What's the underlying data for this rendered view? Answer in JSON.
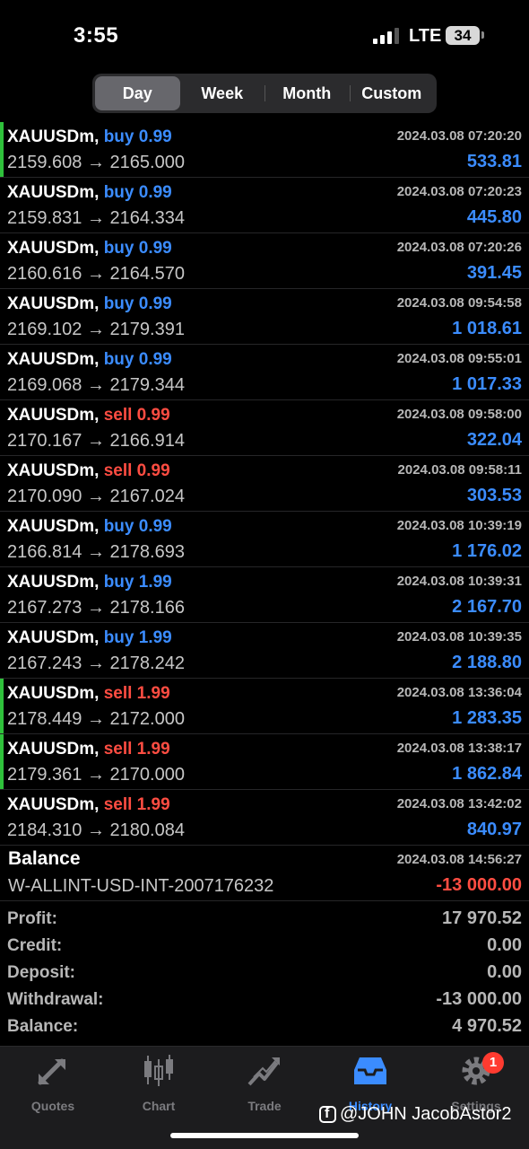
{
  "status_bar": {
    "time": "3:55",
    "network": "LTE",
    "battery": "34"
  },
  "period_tabs": [
    {
      "label": "Day",
      "active": true
    },
    {
      "label": "Week",
      "active": false
    },
    {
      "label": "Month",
      "active": false
    },
    {
      "label": "Custom",
      "active": false
    }
  ],
  "deals": [
    {
      "symbol": "XAUUSDm,",
      "side": "buy",
      "volume": "0.99",
      "datetime": "2024.03.08 07:20:20",
      "prices": "2159.608 → 2165.000",
      "profit": "533.81",
      "marked": true
    },
    {
      "symbol": "XAUUSDm,",
      "side": "buy",
      "volume": "0.99",
      "datetime": "2024.03.08 07:20:23",
      "prices": "2159.831 → 2164.334",
      "profit": "445.80",
      "marked": false
    },
    {
      "symbol": "XAUUSDm,",
      "side": "buy",
      "volume": "0.99",
      "datetime": "2024.03.08 07:20:26",
      "prices": "2160.616 → 2164.570",
      "profit": "391.45",
      "marked": false
    },
    {
      "symbol": "XAUUSDm,",
      "side": "buy",
      "volume": "0.99",
      "datetime": "2024.03.08 09:54:58",
      "prices": "2169.102 → 2179.391",
      "profit": "1 018.61",
      "marked": false
    },
    {
      "symbol": "XAUUSDm,",
      "side": "buy",
      "volume": "0.99",
      "datetime": "2024.03.08 09:55:01",
      "prices": "2169.068 → 2179.344",
      "profit": "1 017.33",
      "marked": false
    },
    {
      "symbol": "XAUUSDm,",
      "side": "sell",
      "volume": "0.99",
      "datetime": "2024.03.08 09:58:00",
      "prices": "2170.167 → 2166.914",
      "profit": "322.04",
      "marked": false
    },
    {
      "symbol": "XAUUSDm,",
      "side": "sell",
      "volume": "0.99",
      "datetime": "2024.03.08 09:58:11",
      "prices": "2170.090 → 2167.024",
      "profit": "303.53",
      "marked": false
    },
    {
      "symbol": "XAUUSDm,",
      "side": "buy",
      "volume": "0.99",
      "datetime": "2024.03.08 10:39:19",
      "prices": "2166.814 → 2178.693",
      "profit": "1 176.02",
      "marked": false
    },
    {
      "symbol": "XAUUSDm,",
      "side": "buy",
      "volume": "1.99",
      "datetime": "2024.03.08 10:39:31",
      "prices": "2167.273 → 2178.166",
      "profit": "2 167.70",
      "marked": false
    },
    {
      "symbol": "XAUUSDm,",
      "side": "buy",
      "volume": "1.99",
      "datetime": "2024.03.08 10:39:35",
      "prices": "2167.243 → 2178.242",
      "profit": "2 188.80",
      "marked": false
    },
    {
      "symbol": "XAUUSDm,",
      "side": "sell",
      "volume": "1.99",
      "datetime": "2024.03.08 13:36:04",
      "prices": "2178.449 → 2172.000",
      "profit": "1 283.35",
      "marked": true
    },
    {
      "symbol": "XAUUSDm,",
      "side": "sell",
      "volume": "1.99",
      "datetime": "2024.03.08 13:38:17",
      "prices": "2179.361 → 2170.000",
      "profit": "1 862.84",
      "marked": true
    },
    {
      "symbol": "XAUUSDm,",
      "side": "sell",
      "volume": "1.99",
      "datetime": "2024.03.08 13:42:02",
      "prices": "2184.310 → 2180.084",
      "profit": "840.97",
      "marked": false
    }
  ],
  "balance_op": {
    "title": "Balance",
    "datetime": "2024.03.08 14:56:27",
    "account": "W-ALLINT-USD-INT-2007176232",
    "amount": "-13 000.00"
  },
  "summary": [
    {
      "label": "Profit:",
      "value": "17 970.52"
    },
    {
      "label": "Credit:",
      "value": "0.00"
    },
    {
      "label": "Deposit:",
      "value": "0.00"
    },
    {
      "label": "Withdrawal:",
      "value": "-13 000.00"
    },
    {
      "label": "Balance:",
      "value": "4 970.52"
    }
  ],
  "tab_bar": [
    {
      "label": "Quotes",
      "icon": "quotes-icon",
      "active": false
    },
    {
      "label": "Chart",
      "icon": "candlestick-icon",
      "active": false
    },
    {
      "label": "Trade",
      "icon": "trade-icon",
      "active": false
    },
    {
      "label": "History",
      "icon": "inbox-icon",
      "active": true
    },
    {
      "label": "Settings",
      "icon": "gear-icon",
      "active": false,
      "badge": "1"
    }
  ],
  "watermark": "@JOHN JacobAstor2",
  "colors": {
    "buy": "#3b8cff",
    "sell": "#ff4d42",
    "marker": "#2fc13b",
    "active_tab": "#3b8cff"
  }
}
